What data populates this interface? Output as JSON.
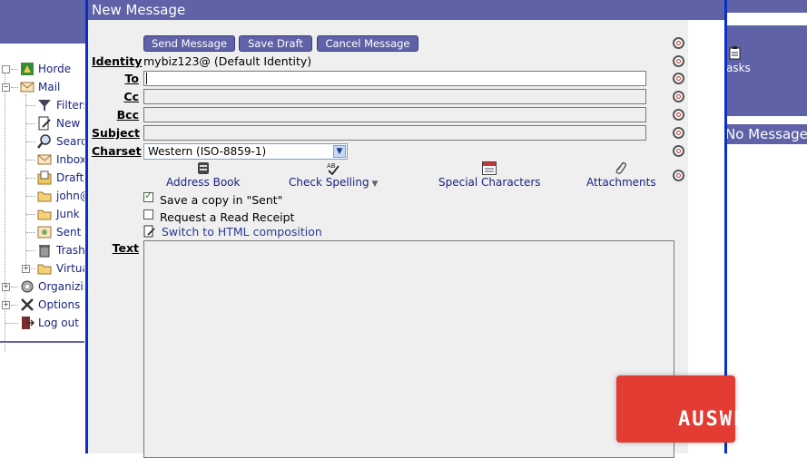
{
  "background": {
    "sidebar": {
      "items": [
        {
          "label": "Horde",
          "icon": "horde-icon"
        },
        {
          "label": "Mail",
          "icon": "mail-icon"
        },
        {
          "label": "Filters",
          "icon": "filter-icon"
        },
        {
          "label": "New M",
          "icon": "compose-icon"
        },
        {
          "label": "Search",
          "icon": "search-icon"
        },
        {
          "label": "Inbox",
          "icon": "inbox-icon"
        },
        {
          "label": "Drafts",
          "icon": "drafts-icon"
        },
        {
          "label": "john@",
          "icon": "folder-icon"
        },
        {
          "label": "Junk",
          "icon": "folder-icon"
        },
        {
          "label": "Sent",
          "icon": "sent-icon"
        },
        {
          "label": "Trash",
          "icon": "trash-icon"
        },
        {
          "label": "Virtua",
          "icon": "folder-icon"
        },
        {
          "label": "Organizin",
          "icon": "organizing-icon"
        },
        {
          "label": "Options",
          "icon": "options-icon"
        },
        {
          "label": "Log out",
          "icon": "logout-icon"
        }
      ]
    },
    "tasks_label": "asks",
    "no_messages_label": "No Message"
  },
  "compose": {
    "title": "New Message",
    "buttons": {
      "send": "Send Message",
      "save_draft": "Save Draft",
      "cancel": "Cancel Message"
    },
    "identity_label": "Identity",
    "identity_value": "mybiz123@ (Default Identity)",
    "to_label": "To",
    "cc_label": "Cc",
    "bcc_label": "Bcc",
    "subject_label": "Subject",
    "to_value": "",
    "cc_value": "",
    "bcc_value": "",
    "subject_value": "",
    "charset_label": "Charset",
    "charset_value": "Western (ISO-8859-1)",
    "tools": {
      "address_book": "Address Book",
      "check_spelling": "Check Spelling",
      "special_characters": "Special Characters",
      "attachments": "Attachments"
    },
    "save_copy_label": "Save a copy in \"Sent\"",
    "save_copy_checked": true,
    "read_receipt_label": "Request a Read Receipt",
    "read_receipt_checked": false,
    "switch_html_label": "Switch to HTML composition",
    "text_label": "Text",
    "body_text": ""
  },
  "watermark": "AUSWEB",
  "colors": {
    "header_purple": "#5f62a6",
    "window_border": "#0a2fc9",
    "form_bg": "#efeff0",
    "link": "#1a237e",
    "watermark_red": "#e23c33"
  }
}
